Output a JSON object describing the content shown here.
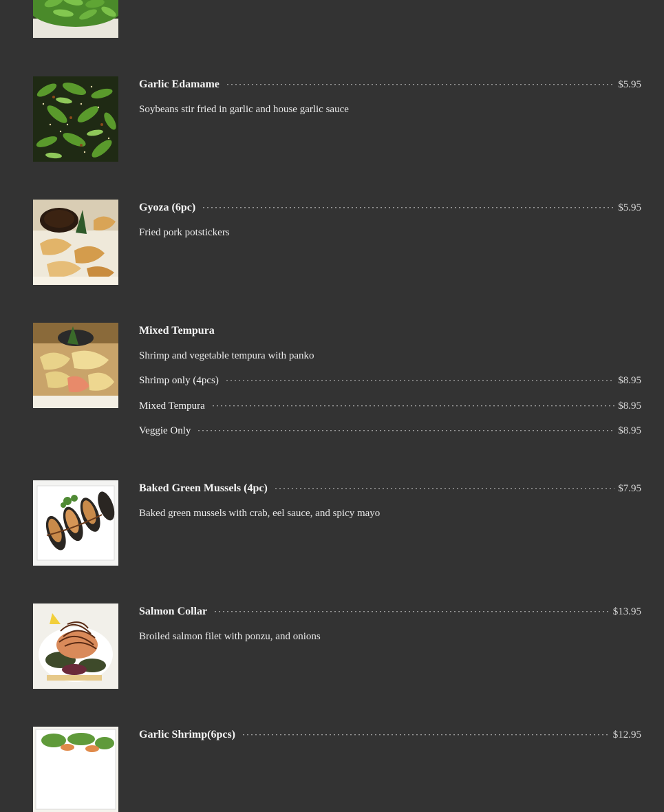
{
  "menu": {
    "items": [
      {
        "name": "",
        "image_icon": "edamame-photo",
        "price": "",
        "description": ""
      },
      {
        "name": "Garlic Edamame",
        "image_icon": "garlic-edamame-photo",
        "price": "$5.95",
        "description": "Soybeans stir fried in garlic and house garlic sauce"
      },
      {
        "name": "Gyoza (6pc)",
        "image_icon": "gyoza-photo",
        "price": "$5.95",
        "description": "Fried pork potstickers"
      },
      {
        "name": "Mixed Tempura",
        "image_icon": "tempura-photo",
        "price": "",
        "description": "Shrimp and vegetable tempura with panko",
        "options": [
          {
            "label": "Shrimp only (4pcs)",
            "price": "$8.95"
          },
          {
            "label": "Mixed Tempura",
            "price": "$8.95"
          },
          {
            "label": "Veggie Only",
            "price": "$8.95"
          }
        ]
      },
      {
        "name": "Baked Green Mussels (4pc)",
        "image_icon": "mussels-photo",
        "price": "$7.95",
        "description": "Baked green mussels with crab, eel sauce, and spicy mayo"
      },
      {
        "name": "Salmon Collar",
        "image_icon": "salmon-collar-photo",
        "price": "$13.95",
        "description": "Broiled salmon filet with ponzu, and onions"
      },
      {
        "name": "Garlic Shrimp(6pcs)",
        "image_icon": "garlic-shrimp-photo",
        "price": "$12.95",
        "description": ""
      }
    ]
  },
  "colors": {
    "background": "#333333",
    "text": "#f2f2f2",
    "leader_dots": "#9a9a9a"
  }
}
